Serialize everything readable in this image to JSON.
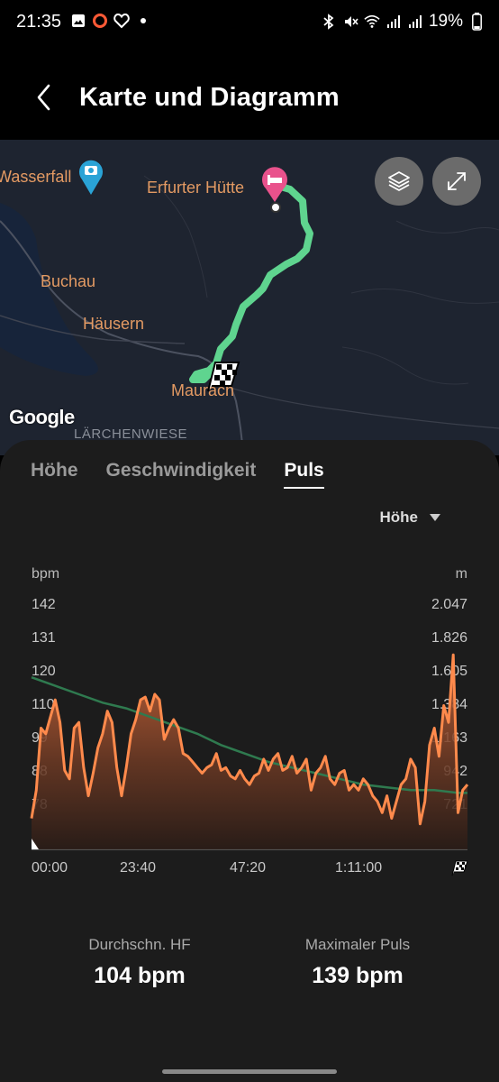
{
  "status_bar": {
    "time": "21:35",
    "battery": "19%"
  },
  "header": {
    "title": "Karte und Diagramm"
  },
  "map": {
    "labels": {
      "wasserfall": "Wasserfall",
      "erfurter_huette": "Erfurter Hütte",
      "buchau": "Buchau",
      "haeusern": "Häusern",
      "maurach": "Maurach",
      "laerchenwiese": "LÄRCHENWIESE"
    },
    "attribution": "Google",
    "route_color": "#5fd48f"
  },
  "tabs": [
    {
      "label": "Höhe",
      "active": false
    },
    {
      "label": "Geschwindigkeit",
      "active": false
    },
    {
      "label": "Puls",
      "active": true
    }
  ],
  "dropdown": {
    "label": "Höhe"
  },
  "chart_data": {
    "type": "area",
    "left_axis": {
      "unit": "bpm",
      "ticks": [
        "142",
        "131",
        "120",
        "110",
        "99",
        "88",
        "78"
      ],
      "range": [
        67,
        153
      ]
    },
    "right_axis": {
      "unit": "m",
      "ticks": [
        "2.047",
        "1.826",
        "1.605",
        "1.384",
        "1.163",
        "942",
        "721"
      ]
    },
    "x_ticks": [
      "00:00",
      "23:40",
      "47:20",
      "1:11:00"
    ],
    "x_range_minutes": [
      0,
      92
    ],
    "series": [
      {
        "color": "#ff8a4c",
        "x": [
          0,
          1,
          2,
          3,
          4,
          5,
          6,
          7,
          8,
          9,
          10,
          11,
          12,
          13,
          14,
          15,
          16,
          17,
          18,
          19,
          20,
          21,
          22,
          23,
          24,
          25,
          26,
          27,
          28,
          29,
          30,
          31,
          32,
          33,
          34,
          35,
          36,
          37,
          38,
          39,
          40,
          41,
          42,
          43,
          44,
          45,
          46,
          47,
          48,
          49,
          50,
          51,
          52,
          53,
          54,
          55,
          56,
          57,
          58,
          59,
          60,
          61,
          62,
          63,
          64,
          65,
          66,
          67,
          68,
          69,
          70,
          71,
          72,
          73,
          74,
          75,
          76,
          77,
          78,
          79,
          80,
          81,
          82,
          83,
          84,
          85,
          86,
          87,
          88,
          89,
          90,
          91,
          92
        ],
        "y": [
          78,
          88,
          110,
          108,
          114,
          120,
          112,
          95,
          92,
          110,
          112,
          96,
          86,
          94,
          103,
          108,
          116,
          112,
          96,
          86,
          96,
          108,
          113,
          120,
          121,
          116,
          122,
          120,
          106,
          110,
          113,
          110,
          101,
          100,
          98,
          96,
          94,
          96,
          97,
          101,
          95,
          96,
          93,
          92,
          95,
          92,
          90,
          93,
          94,
          99,
          95,
          99,
          101,
          95,
          96,
          100,
          94,
          96,
          99,
          88,
          94,
          96,
          100,
          92,
          90,
          94,
          95,
          88,
          90,
          88,
          92,
          90,
          86,
          84,
          80,
          86,
          78,
          84,
          90,
          92,
          99,
          96,
          76,
          84,
          104,
          110,
          100,
          118,
          112,
          136,
          80,
          88,
          90
        ]
      },
      {
        "color": "#2f7a4f",
        "x": [
          0,
          5,
          10,
          15,
          20,
          25,
          30,
          35,
          40,
          45,
          50,
          55,
          60,
          65,
          70,
          75,
          80,
          85,
          90,
          92
        ],
        "y": [
          128,
          125,
          122,
          119,
          117,
          114,
          111,
          108,
          104,
          101,
          98,
          96,
          94,
          92,
          90,
          89,
          88,
          88,
          87,
          87
        ]
      }
    ],
    "stats": [
      {
        "label": "Durchschn. HF",
        "value": "104 bpm"
      },
      {
        "label": "Maximaler Puls",
        "value": "139 bpm"
      }
    ]
  }
}
